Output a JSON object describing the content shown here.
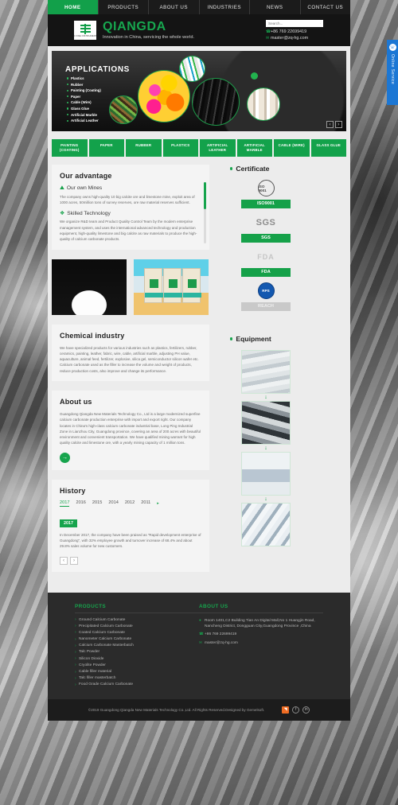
{
  "nav": {
    "items": [
      {
        "label": "HOME",
        "active": true
      },
      {
        "label": "PRODUCTS",
        "active": false
      },
      {
        "label": "ABOUT US",
        "active": false
      },
      {
        "label": "INDUSTRIES",
        "active": false
      },
      {
        "label": "NEWS",
        "active": false
      },
      {
        "label": "CONTACT US",
        "active": false
      }
    ]
  },
  "header": {
    "logo_sub": "A FINE INSTRUMENT",
    "brand_name": "QIANGDA",
    "slogan": "Innovation in China, servicing the whole world.",
    "search_placeholder": "Search...",
    "search_value": "",
    "phone": "+86 769 22699419",
    "email": "master@zq-hg.com",
    "phone_icon": "phone-icon",
    "email_icon": "email-icon",
    "search_icon": "search-icon"
  },
  "banner": {
    "title": "APPLICATIONS",
    "items": [
      "Plastics",
      "Rubber",
      "Painting  (Coating)",
      "Paper",
      "Cable  (Wire)",
      "Glass Glue",
      "Artificial Marble",
      "Artificial Leather"
    ],
    "prev_label": "‹",
    "next_label": "›"
  },
  "categories": [
    "PAINTING (COATING)",
    "PAPER",
    "RUBBER",
    "PLASTICS",
    "ARTIFICIAL LEATHER",
    "ARTIFICIAL MARBLE",
    "CABLE (WIRE)",
    "GLASS GLUE"
  ],
  "advantage": {
    "title": "Our advantage",
    "blocks": [
      {
        "icon": "mountain-icon",
        "heading": "Our own Mines",
        "text": "The company owns high-quality 10 big calcite ore and limestone mine, exploit area of 1000 acres, 50million tons of survey reserves, ore raw material reserves sufficient."
      },
      {
        "icon": "gears-icon",
        "heading": "Skilled Technology",
        "text": "We organize R&D team and Product Quality Control Team by the modern enterprise management system, and uses the international advanced technology and production equipment, high-quality limestone and big calcite as raw materials to produce the high- quality of calcium carbonate products."
      }
    ]
  },
  "product_images": [
    {
      "name": "calcium-carbonate-powder-photo"
    },
    {
      "name": "packaging-bags-photo"
    }
  ],
  "chemical": {
    "title": "Chemical industry",
    "text": "We have specialized products for various industries such as plastics, fertilizers, rubber, ceramics, painting, leather, fabric, wire, cable, artificial marble, adjusting PH value, aquaculture, animal feed, fertilizer, explosive, silica gel, semiconductor silicon wafer etc. Calcium carbonate used as the filler to increase the volume and weight of products, reduce production costs, also improve and change its performance."
  },
  "about": {
    "title": "About us",
    "text": "Guangdong Qiangda New Materials Technology Co., Ltd is a large modernized superfine calcium carbonate production enterprise with import and export right. Our company locates in China's high-class calcium carbonate industrial base, Long Ping Industrial Zone in Lianzhou City, Guangdong province, covering an area of 200 acres with beautiful environment and convenient transportation. We have qualified mining warrant for high quality calcite and limestone ore, with a yearly mining capacity of 1 million tons.",
    "more_label": "→"
  },
  "history": {
    "title": "History",
    "years": [
      "2017",
      "2016",
      "2015",
      "2014",
      "2012",
      "2011"
    ],
    "active_year": "2017",
    "next_arrow": "▸",
    "badge": "2017",
    "text": "In December 2017, the company have been praised as \"Rapid development enterprise of Guangdong\", with 32% employee growth and turnover increase of 68.4% and about 29.8% sales volume for new customers.",
    "prev_label": "‹",
    "next_label": "›"
  },
  "certificate": {
    "title": "Certificate",
    "items": [
      {
        "logo_type": "seal",
        "logo_text": "ISO 9001",
        "button": "ISO9001",
        "disabled": false
      },
      {
        "logo_type": "word-sgs",
        "logo_text": "SGS",
        "button": "SGS",
        "disabled": false
      },
      {
        "logo_type": "word-fda",
        "logo_text": "FDA",
        "button": "FDA",
        "disabled": false
      },
      {
        "logo_type": "seal-blue",
        "logo_text": "RPS",
        "button": "REACH",
        "disabled": true
      }
    ]
  },
  "equipment": {
    "title": "Equipment",
    "items": [
      {
        "name": "grinding-mill-photo"
      },
      {
        "name": "classifier-machine-photo"
      },
      {
        "name": "laboratory-staff-photo"
      },
      {
        "name": "lab-testing-photo"
      }
    ],
    "arrow": "↓"
  },
  "footer": {
    "products_title": "PRODUCTS",
    "products": [
      "Ground Calcium Carbonate",
      "Precipitated Calcium Carbonate",
      "Coated Calcium Carbonate",
      "Nanometer Calcium Carbonate",
      "Calcium Carbonate Masterbatch",
      "Talc Powder",
      "Silicon Dioxide",
      "Cryolite Powder",
      "Cable filler material",
      "Talc filler masterbatch",
      "Food Grade Calcium Carbonate"
    ],
    "about_title": "ABOUT US",
    "address": "Room 1401,C2 Building Tian An Digital Mall,No 1 Huangjin Road, Nancheng District, Dongguan City,Guangdong Province ,China",
    "phone": "+86 769 22699419",
    "email": "master@zq-hg.com",
    "location_icon": "location-pin-icon",
    "phone_icon": "phone-icon",
    "email_icon": "email-icon"
  },
  "copyright": {
    "text": "©2019 Guangdong Qiangda New Materials Technology Co.,Ltd. All Rights Reserved.Designed by Gemelsoft.",
    "socials": [
      {
        "name": "analytics-icon",
        "glyph": "◥"
      },
      {
        "name": "facebook-icon",
        "glyph": "f"
      },
      {
        "name": "linkedin-icon",
        "glyph": "in"
      }
    ]
  },
  "online_service": {
    "label": "Online Service",
    "icon": "headset-icon"
  },
  "colors": {
    "brand_green": "#17a44d",
    "nav_dark": "#1b1b1b",
    "footer_dark": "#2b2b2b",
    "online_blue": "#1c77d4"
  }
}
